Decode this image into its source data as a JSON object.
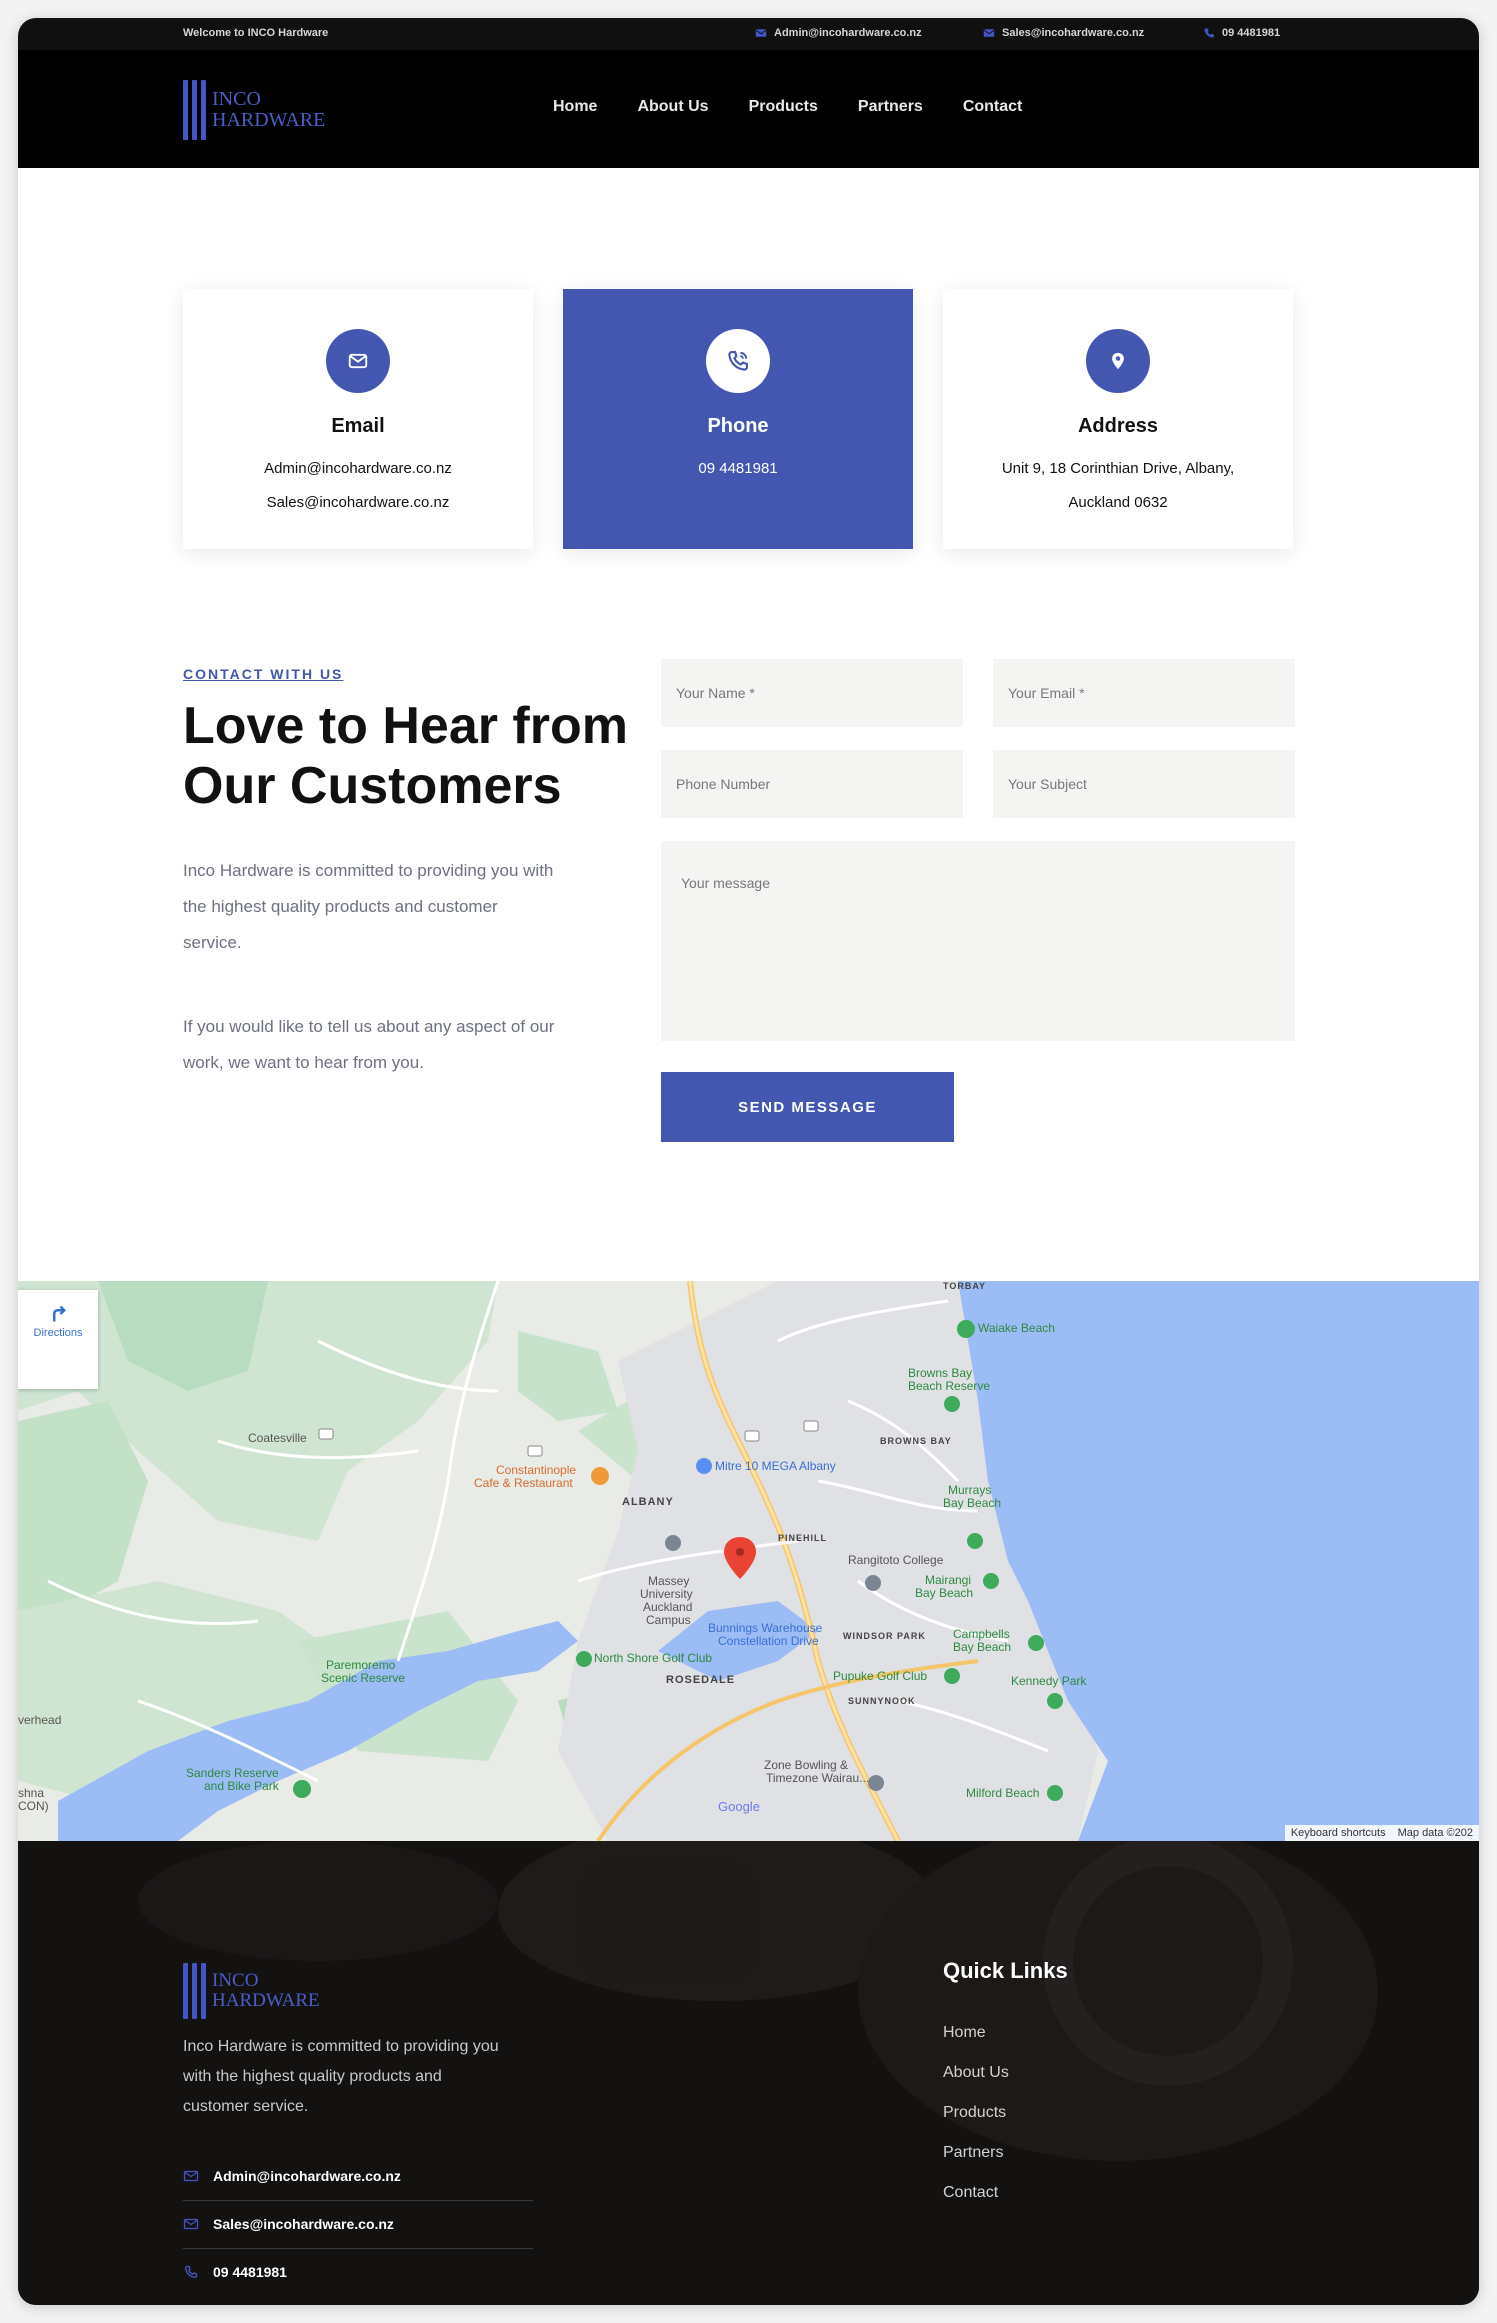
{
  "topbar": {
    "welcome": "Welcome to INCO Hardware",
    "email_admin": "Admin@incohardware.co.nz",
    "email_sales": "Sales@incohardware.co.nz",
    "phone": "09 4481981"
  },
  "header": {
    "logo_line1": "INCO",
    "logo_line2": "HARDWARE",
    "nav": [
      "Home",
      "About Us",
      "Products",
      "Partners",
      "Contact"
    ]
  },
  "cards": {
    "email": {
      "title": "Email",
      "lines": [
        "Admin@incohardware.co.nz",
        "Sales@incohardware.co.nz"
      ]
    },
    "phone": {
      "title": "Phone",
      "lines": [
        "09 4481981"
      ]
    },
    "address": {
      "title": "Address",
      "lines": [
        "Unit 9, 18 Corinthian Drive, Albany,",
        "Auckland 0632"
      ]
    }
  },
  "contact": {
    "eyebrow": "CONTACT WITH US",
    "title_line1": "Love to Hear from",
    "title_line2": "Our Customers",
    "para1_l1": "Inco Hardware is committed to providing you with",
    "para1_l2": "the highest quality products and customer",
    "para1_l3": "service.",
    "para2_l1": "If you would like to tell us about any aspect of our",
    "para2_l2": "work, we want to hear from you.",
    "form": {
      "name_placeholder": "Your Name *",
      "email_placeholder": "Your Email *",
      "phone_placeholder": "Phone Number",
      "subject_placeholder": "Your Subject",
      "message_placeholder": "Your message",
      "send_label": "SEND MESSAGE"
    }
  },
  "map": {
    "directions": "Directions",
    "keyboard": "Keyboard shortcuts",
    "mapdata": "Map data ©202",
    "google": "Google",
    "labels": {
      "torbay": "TORBAY",
      "waiake": "Waiake Beach",
      "browns_bay_reserve_1": "Browns Bay",
      "browns_bay_reserve_2": "Beach Reserve",
      "browns_bay": "BROWNS BAY",
      "coatesville": "Coatesville",
      "constantinople_1": "Constantinople",
      "constantinople_2": "Cafe & Restaurant",
      "mitre10": "Mitre 10 MEGA Albany",
      "albany": "ALBANY",
      "pinehill": "PINEHILL",
      "murrays_1": "Murrays",
      "murrays_2": "Bay Beach",
      "rangitoto": "Rangitoto College",
      "mairangi_1": "Mairangi",
      "mairangi_2": "Bay Beach",
      "massey_1": "Massey",
      "massey_2": "University",
      "massey_3": "Auckland",
      "massey_4": "Campus",
      "bunnings_1": "Bunnings Warehouse",
      "bunnings_2": "Constellation Drive",
      "windsor": "WINDSOR PARK",
      "campbells_1": "Campbells",
      "campbells_2": "Bay Beach",
      "paremoremo_1": "Paremoremo",
      "paremoremo_2": "Scenic Reserve",
      "northshore": "North Shore Golf Club",
      "rosedale": "ROSEDALE",
      "pupuke": "Pupuke Golf Club",
      "kennedy": "Kennedy Park",
      "sunnynook": "SUNNYNOOK",
      "overhead": "verhead",
      "sanders_1": "Sanders Reserve",
      "sanders_2": "and Bike Park",
      "zone_1": "Zone Bowling &",
      "zone_2": "Timezone Wairau...",
      "milford": "Milford Beach",
      "hshna": "shna",
      "con": "CON)"
    }
  },
  "footer": {
    "logo_line1": "INCO",
    "logo_line2": "HARDWARE",
    "para_l1": "Inco Hardware is committed to providing you",
    "para_l2": "with the highest quality products and",
    "para_l3": "customer service.",
    "email_admin": "Admin@incohardware.co.nz",
    "email_sales": "Sales@incohardware.co.nz",
    "phone": "09 4481981",
    "quick_title": "Quick Links",
    "quick_links": [
      "Home",
      "About Us",
      "Products",
      "Partners",
      "Contact"
    ]
  },
  "colors": {
    "brand": "#4356b0",
    "header_bg": "#000000",
    "field_bg": "#f4f4f2",
    "water": "#9bbcf5"
  }
}
